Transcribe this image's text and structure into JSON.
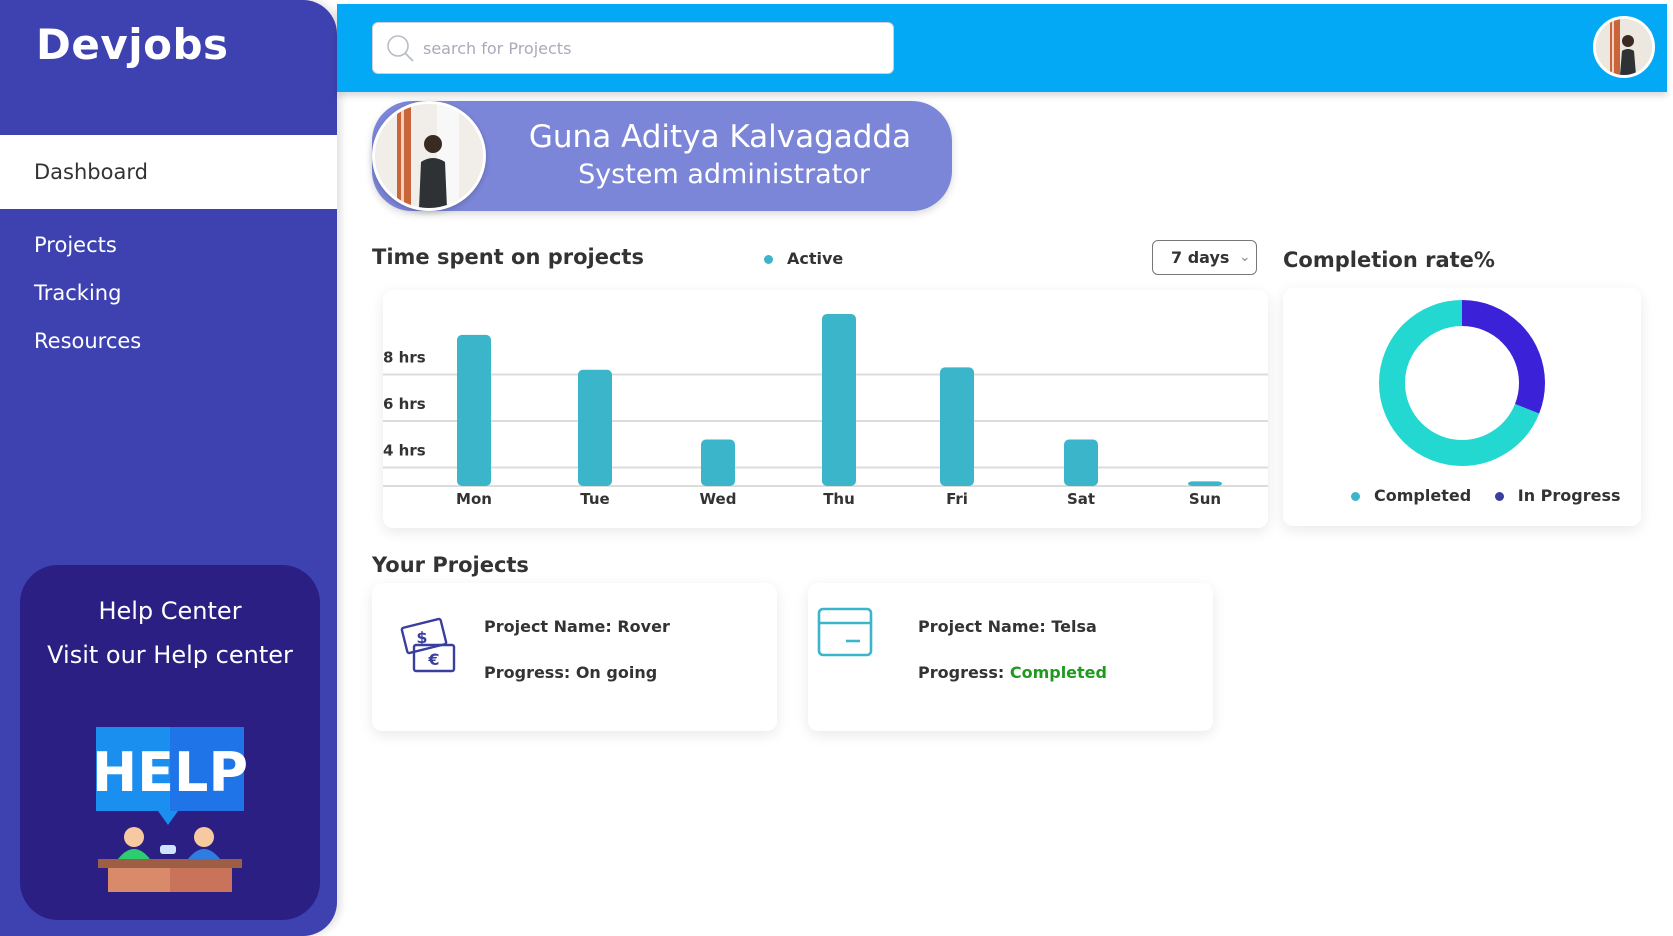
{
  "brand": "Devjobs",
  "sidebar": {
    "items": [
      {
        "label": "Dashboard",
        "active": true
      },
      {
        "label": "Projects",
        "active": false
      },
      {
        "label": "Tracking",
        "active": false
      },
      {
        "label": "Resources",
        "active": false
      }
    ]
  },
  "help_center": {
    "title": "Help Center",
    "subtitle": "Visit our Help center",
    "illustration_text": "HELP"
  },
  "header": {
    "search_placeholder": "search for Projects",
    "search_icon": "search-icon"
  },
  "profile": {
    "name": "Guna Aditya Kalvagadda",
    "role": "System administrator"
  },
  "time_chart": {
    "title": "Time spent on projects",
    "legend": "Active",
    "range_select": "7 days"
  },
  "completion": {
    "title": "Completion rate%",
    "legend_completed": "Completed",
    "legend_in_progress": "In Progress"
  },
  "projects": {
    "title": "Your Projects",
    "items": [
      {
        "name_label": "Project Name:",
        "name": "Rover",
        "progress_label": "Progress:",
        "progress": "On going",
        "icon": "money-icon"
      },
      {
        "name_label": "Project Name:",
        "name": "Telsa",
        "progress_label": "Progress:",
        "progress": "Completed",
        "icon": "credit-card-icon"
      }
    ]
  },
  "colors": {
    "sidebar": "#3e42b0",
    "help_card": "#2b1f84",
    "topbar": "#03a9f4",
    "profile_banner": "#7c86d8",
    "bar": "#3bb5c9",
    "donut_completed": "#22d8d0",
    "donut_in_progress": "#3b22d8",
    "completed_text": "#1f9a1f"
  },
  "chart_data": [
    {
      "type": "bar",
      "title": "Time spent on projects",
      "categories": [
        "Mon",
        "Tue",
        "Wed",
        "Thu",
        "Fri",
        "Sat",
        "Sun"
      ],
      "series": [
        {
          "name": "Active",
          "values": [
            8.5,
            7.0,
            4.0,
            9.4,
            7.1,
            4.0,
            2.2
          ]
        }
      ],
      "ytick_labels": [
        "4 hrs",
        "6 hrs",
        "8 hrs"
      ],
      "yticks": [
        4,
        6,
        8
      ],
      "ylim": [
        2,
        10
      ],
      "grid": true
    },
    {
      "type": "pie",
      "title": "Completion rate%",
      "labels": [
        "Completed",
        "In Progress"
      ],
      "values": [
        69,
        31
      ],
      "donut": true,
      "legend": "bottom"
    }
  ]
}
